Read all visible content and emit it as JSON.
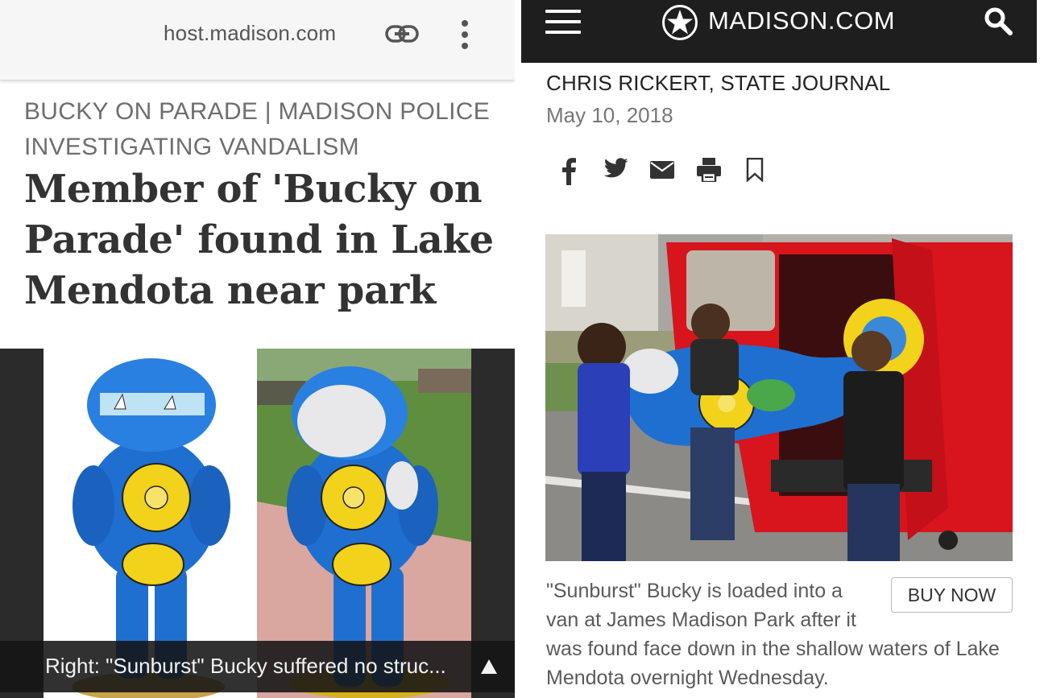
{
  "left": {
    "browser": {
      "url": "host.madison.com"
    },
    "article": {
      "kicker": "BUCKY ON PARADE | MADISON POLICE INVESTIGATING VANDALISM",
      "headline": "Member of 'Bucky on Parade' found in Lake Mendota near park"
    },
    "photo": {
      "caption": "Right: \"Sunburst\" Bucky suffered no struc..."
    }
  },
  "right": {
    "header": {
      "brand": "MADISON.COM"
    },
    "article": {
      "byline": "CHRIS RICKERT, STATE JOURNAL",
      "date": "May 10, 2018"
    },
    "share": {
      "icons": [
        "facebook-icon",
        "twitter-icon",
        "email-icon",
        "print-icon",
        "bookmark-icon"
      ]
    },
    "photo": {
      "buy_label": "BUY NOW",
      "caption_lines": [
        "\"Sunburst\" Bucky is loaded into a",
        "van at James Madison Park after it",
        "was found face down in the shallow waters of Lake",
        "Mendota overnight Wednesday."
      ]
    }
  },
  "colors": {
    "nav_bg": "#1e1e1e",
    "statue_blue": "#1f6fd1",
    "sun_yellow": "#f2d21a",
    "van_red": "#d8141c"
  }
}
